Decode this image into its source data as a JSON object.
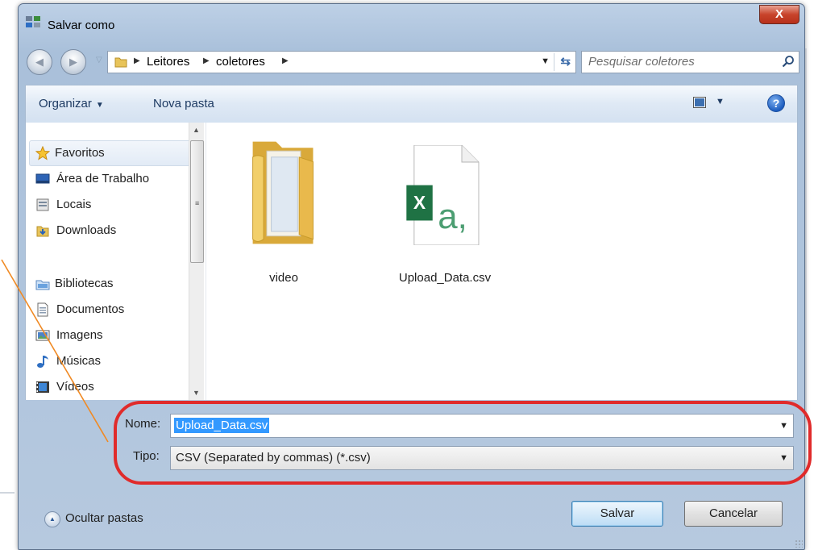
{
  "window": {
    "title": "Salvar como",
    "close_label": "X"
  },
  "address": {
    "crumbs": [
      "Leitores",
      "coletores"
    ],
    "search_placeholder": "Pesquisar coletores"
  },
  "toolbar": {
    "organize_label": "Organizar",
    "new_folder_label": "Nova pasta"
  },
  "navigation": {
    "favorites_label": "Favoritos",
    "favorites": [
      "Área de Trabalho",
      "Locais",
      "Downloads"
    ],
    "libraries_label": "Bibliotecas",
    "libraries": [
      "Documentos",
      "Imagens",
      "Músicas",
      "Vídeos"
    ]
  },
  "files": [
    {
      "name": "video",
      "icon": "folder-icon"
    },
    {
      "name": "Upload_Data.csv",
      "icon": "excel-csv-icon"
    }
  ],
  "save_form": {
    "name_label": "Nome:",
    "name_value": "Upload_Data.csv",
    "type_label": "Tipo:",
    "type_value": "CSV (Separated by commas) (*.csv)"
  },
  "footer": {
    "hide_folders_label": "Ocultar pastas",
    "save_label": "Salvar",
    "cancel_label": "Cancelar"
  },
  "colors": {
    "annotation_oval": "#e02b2b",
    "annotation_line": "#f08a24",
    "selection": "#3399ff"
  }
}
